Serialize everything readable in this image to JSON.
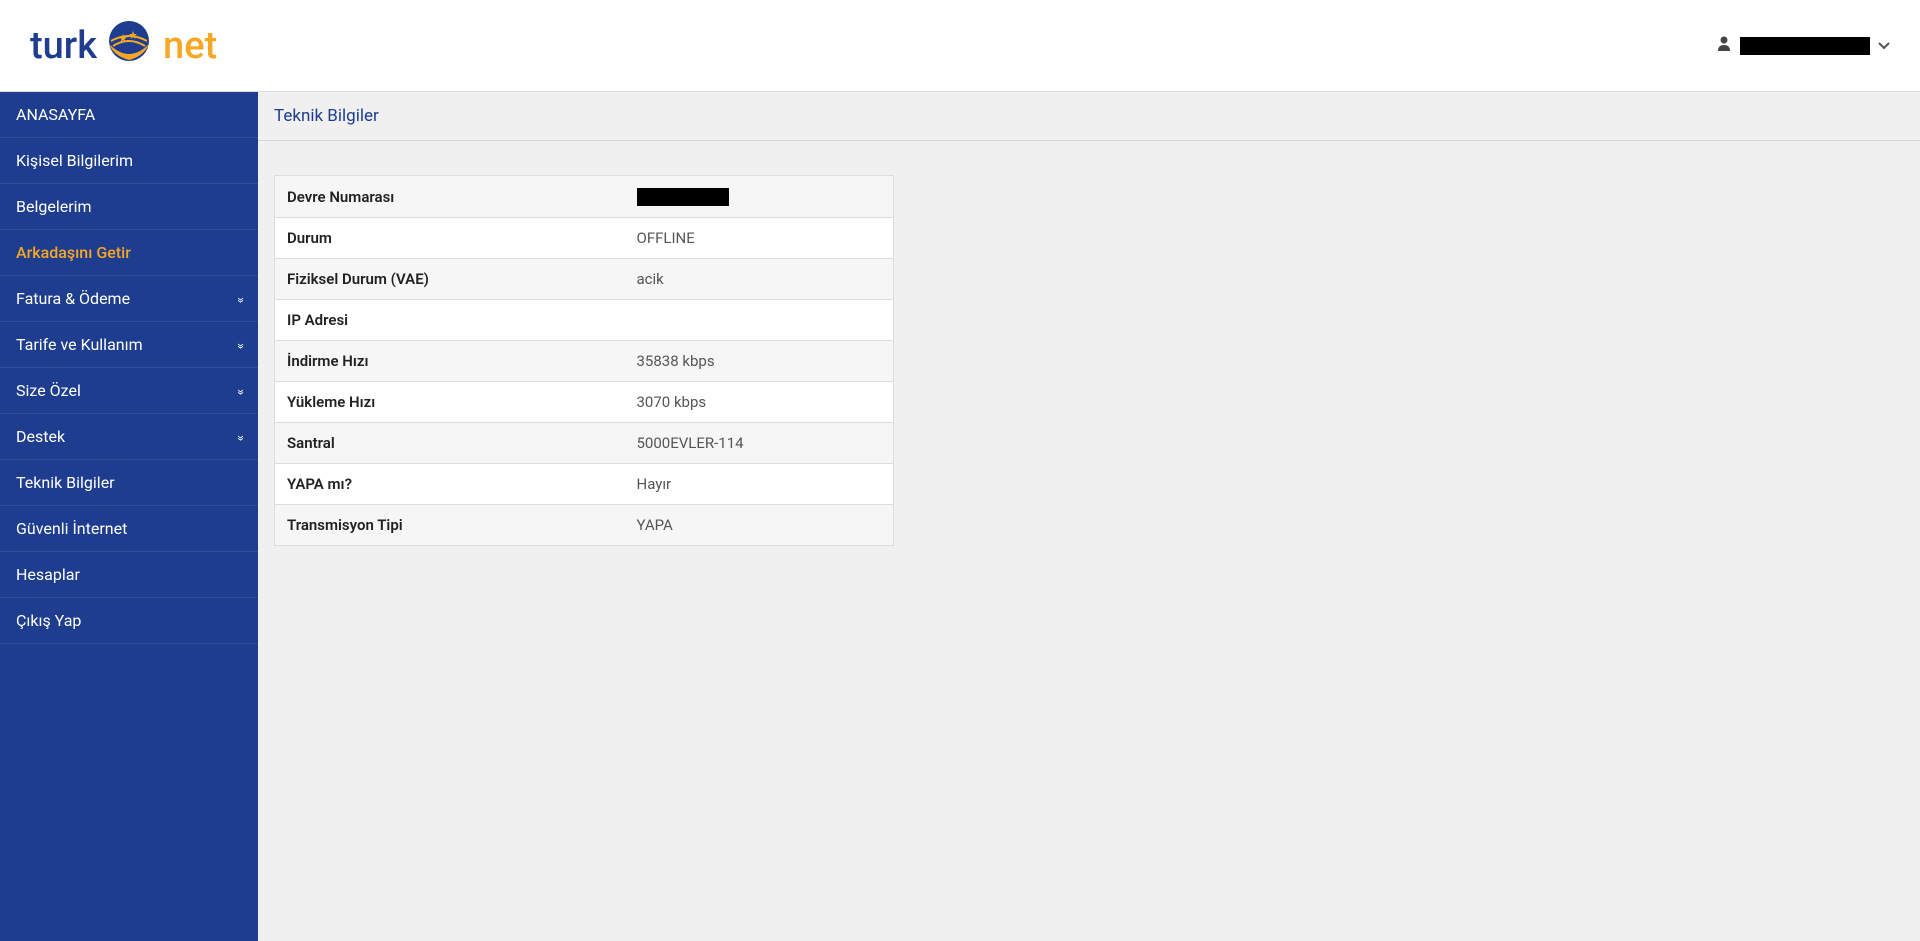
{
  "header": {
    "logo_turk": "turk",
    "logo_net": "net",
    "user_name": ""
  },
  "sidebar": {
    "items": [
      {
        "label": "ANASAYFA",
        "expandable": false,
        "highlight": false
      },
      {
        "label": "Kişisel Bilgilerim",
        "expandable": false,
        "highlight": false
      },
      {
        "label": "Belgelerim",
        "expandable": false,
        "highlight": false
      },
      {
        "label": "Arkadaşını Getir",
        "expandable": false,
        "highlight": true
      },
      {
        "label": "Fatura & Ödeme",
        "expandable": true,
        "highlight": false
      },
      {
        "label": "Tarife ve Kullanım",
        "expandable": true,
        "highlight": false
      },
      {
        "label": "Size Özel",
        "expandable": true,
        "highlight": false
      },
      {
        "label": "Destek",
        "expandable": true,
        "highlight": false
      },
      {
        "label": "Teknik Bilgiler",
        "expandable": false,
        "highlight": false
      },
      {
        "label": "Güvenli İnternet",
        "expandable": false,
        "highlight": false
      },
      {
        "label": "Hesaplar",
        "expandable": false,
        "highlight": false
      },
      {
        "label": "Çıkış Yap",
        "expandable": false,
        "highlight": false
      }
    ]
  },
  "breadcrumb": {
    "title": "Teknik Bilgiler"
  },
  "tech_info": {
    "rows": [
      {
        "label": "Devre Numarası",
        "value": "",
        "redacted": true
      },
      {
        "label": "Durum",
        "value": "OFFLINE",
        "redacted": false
      },
      {
        "label": "Fiziksel Durum (VAE)",
        "value": "acik",
        "redacted": false
      },
      {
        "label": "IP Adresi",
        "value": "",
        "redacted": false
      },
      {
        "label": "İndirme Hızı",
        "value": "35838 kbps",
        "redacted": false
      },
      {
        "label": "Yükleme Hızı",
        "value": "3070 kbps",
        "redacted": false
      },
      {
        "label": "Santral",
        "value": "5000EVLER-114",
        "redacted": false
      },
      {
        "label": "YAPA mı?",
        "value": "Hayır",
        "redacted": false
      },
      {
        "label": "Transmisyon Tipi",
        "value": "YAPA",
        "redacted": false
      }
    ]
  }
}
